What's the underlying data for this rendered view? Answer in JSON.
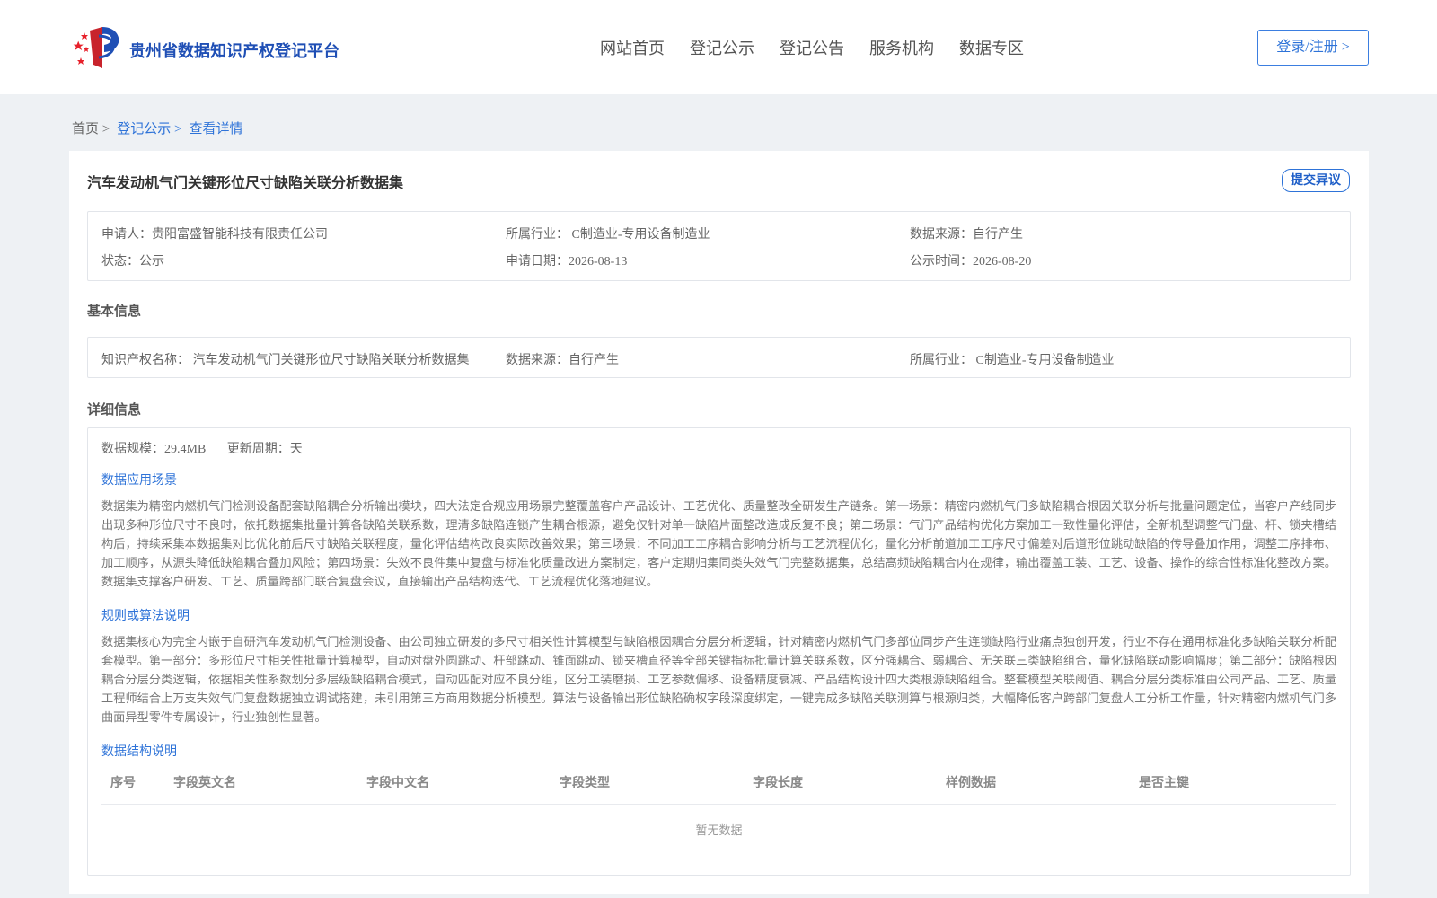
{
  "header": {
    "site_name": "贵州省数据知识产权登记平台",
    "nav": [
      "网站首页",
      "登记公示",
      "登记公告",
      "服务机构",
      "数据专区"
    ],
    "login_label": "登录/注册 >"
  },
  "breadcrumb": {
    "home": "首页 >",
    "section": "登记公示 >",
    "current": "查看详情"
  },
  "record": {
    "title": "汽车发动机气门关键形位尺寸缺陷关联分析数据集",
    "objection_label": "提交异议",
    "applicant": "申请人：贵阳富盛智能科技有限责任公司",
    "industry": "所属行业： C制造业-专用设备制造业",
    "source": "数据来源：自行产生",
    "status": "状态：公示",
    "apply_date": "申请日期：2026-08-13",
    "publish_time": "公示时间：2026-08-20"
  },
  "basic": {
    "section_title": "基本信息",
    "ip_name": "知识产权名称： 汽车发动机气门关键形位尺寸缺陷关联分析数据集",
    "source": "数据来源：自行产生",
    "industry": "所属行业： C制造业-专用设备制造业"
  },
  "detail": {
    "section_title": "详细信息",
    "scale": "数据规模：29.4MB",
    "update_cycle": "更新周期：天",
    "scenario_title": "数据应用场景",
    "scenario_text": "数据集为精密内燃机气门检测设备配套缺陷耦合分析输出模块，四大法定合规应用场景完整覆盖客户产品设计、工艺优化、质量整改全研发生产链条。第一场景：精密内燃机气门多缺陷耦合根因关联分析与批量问题定位，当客户产线同步出现多种形位尺寸不良时，依托数据集批量计算各缺陷关联系数，理清多缺陷连锁产生耦合根源，避免仅针对单一缺陷片面整改造成反复不良；第二场景：气门产品结构优化方案加工一致性量化评估，全新机型调整气门盘、杆、锁夹槽结构后，持续采集本数据集对比优化前后尺寸缺陷关联程度，量化评估结构改良实际改善效果；第三场景：不同加工工序耦合影响分析与工艺流程优化，量化分析前道加工工序尺寸偏差对后道形位跳动缺陷的传导叠加作用，调整工序排布、加工顺序，从源头降低缺陷耦合叠加风险；第四场景：失效不良件集中复盘与标准化质量改进方案制定，客户定期归集同类失效气门完整数据集，总结高频缺陷耦合内在规律，输出覆盖工装、工艺、设备、操作的综合性标准化整改方案。数据集支撑客户研发、工艺、质量跨部门联合复盘会议，直接输出产品结构迭代、工艺流程优化落地建议。",
    "algorithm_title": "规则或算法说明",
    "algorithm_text": "数据集核心为完全内嵌于自研汽车发动机气门检测设备、由公司独立研发的多尺寸相关性计算模型与缺陷根因耦合分层分析逻辑，针对精密内燃机气门多部位同步产生连锁缺陷行业痛点独创开发，行业不存在通用标准化多缺陷关联分析配套模型。第一部分：多形位尺寸相关性批量计算模型，自动对盘外圆跳动、杆部跳动、锥面跳动、锁夹槽直径等全部关键指标批量计算关联系数，区分强耦合、弱耦合、无关联三类缺陷组合，量化缺陷联动影响幅度；第二部分：缺陷根因耦合分层分类逻辑，依据相关性系数划分多层级缺陷耦合模式，自动匹配对应不良分组，区分工装磨损、工艺参数偏移、设备精度衰减、产品结构设计四大类根源缺陷组合。整套模型关联阈值、耦合分层分类标准由公司产品、工艺、质量工程师结合上万支失效气门复盘数据独立调试搭建，未引用第三方商用数据分析模型。算法与设备输出形位缺陷确权字段深度绑定，一键完成多缺陷关联测算与根源归类，大幅降低客户跨部门复盘人工分析工作量，针对精密内燃机气门多曲面异型零件专属设计，行业独创性显著。",
    "structure_title": "数据结构说明",
    "table_headers": [
      "序号",
      "字段英文名",
      "字段中文名",
      "字段类型",
      "字段长度",
      "样例数据",
      "是否主键"
    ],
    "empty_text": "暂无数据"
  }
}
